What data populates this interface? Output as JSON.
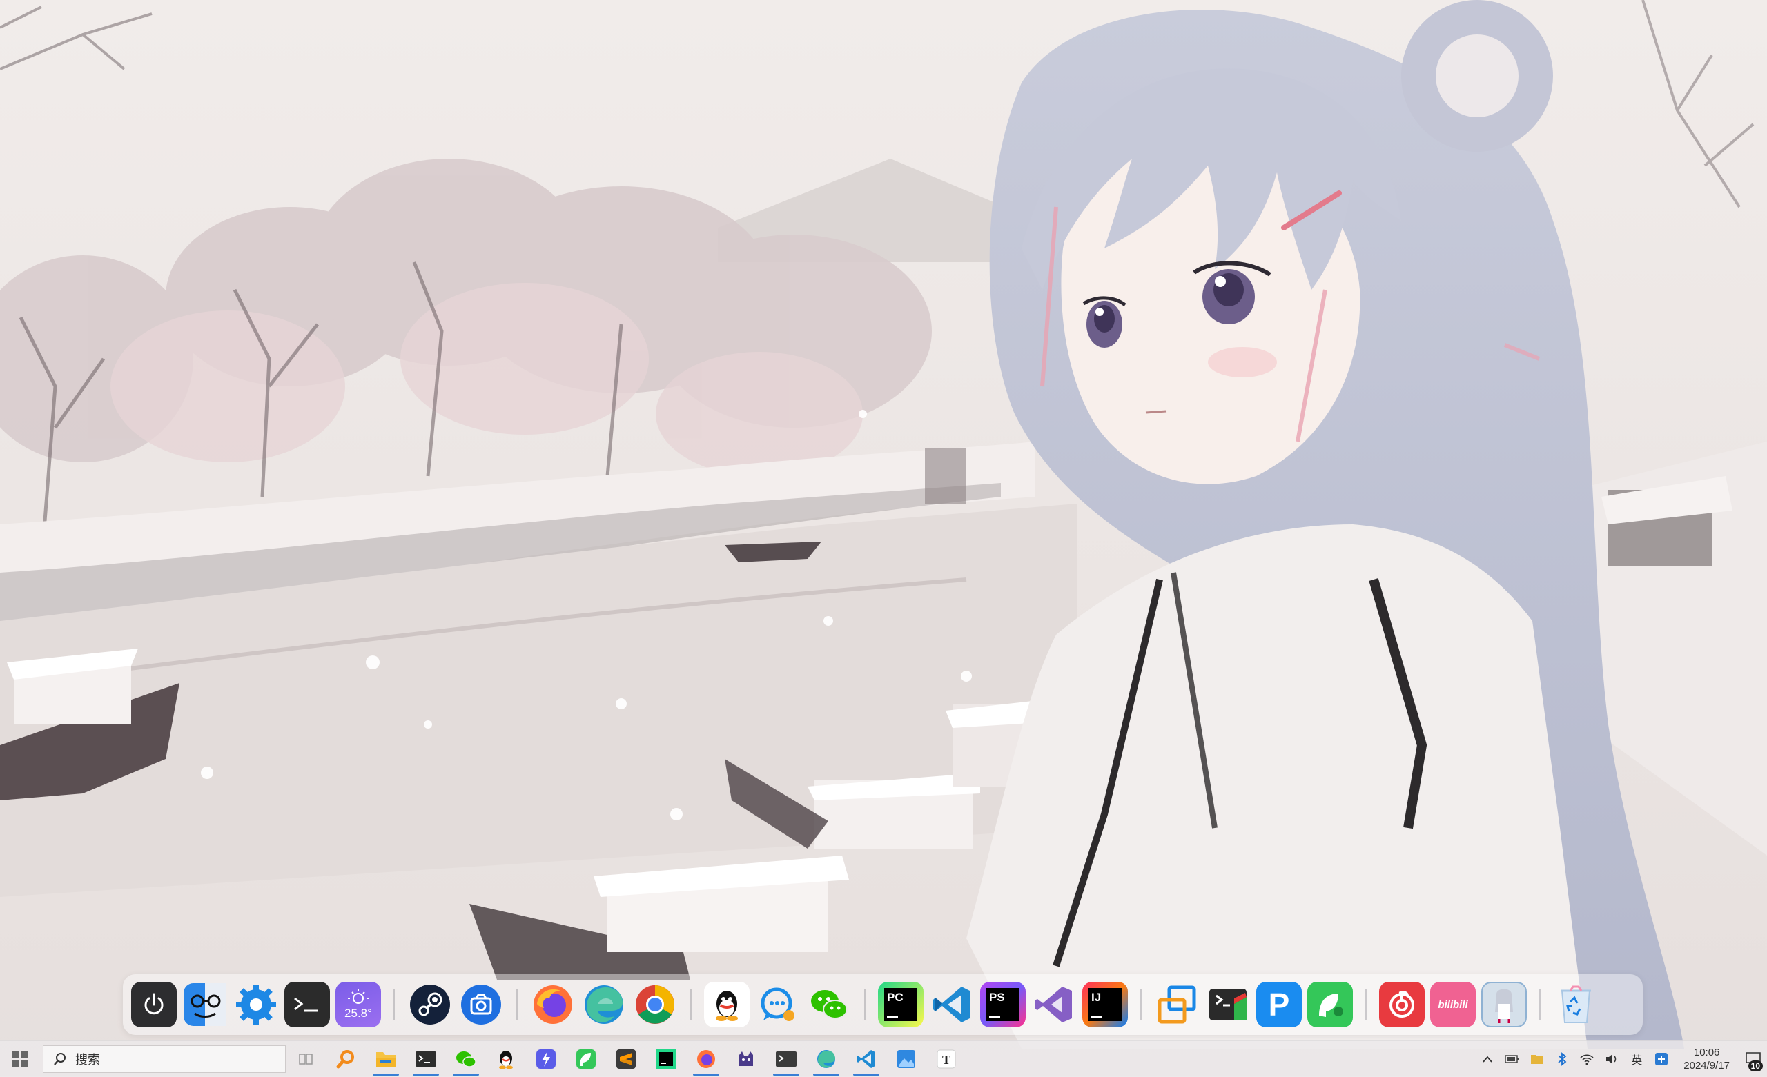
{
  "dock": {
    "apps": [
      {
        "name": "power"
      },
      {
        "name": "finder-face"
      },
      {
        "name": "settings"
      },
      {
        "name": "terminal"
      },
      {
        "name": "weather",
        "temperature": "25.8°"
      },
      {
        "name": "steam"
      },
      {
        "name": "screenshot"
      },
      {
        "name": "firefox"
      },
      {
        "name": "edge"
      },
      {
        "name": "chrome"
      },
      {
        "name": "qq"
      },
      {
        "name": "chat-bubble"
      },
      {
        "name": "wechat"
      },
      {
        "name": "pycharm",
        "label": "PC"
      },
      {
        "name": "vscode"
      },
      {
        "name": "phpstorm",
        "label": "PS"
      },
      {
        "name": "visual-studio"
      },
      {
        "name": "intellij",
        "label": "IJ"
      },
      {
        "name": "window-manager"
      },
      {
        "name": "windows-terminal"
      },
      {
        "name": "p-app",
        "label": "P"
      },
      {
        "name": "green-app"
      },
      {
        "name": "netease-music"
      },
      {
        "name": "bilibili",
        "label": "bilibili"
      },
      {
        "name": "character-card"
      },
      {
        "name": "recycle-bin"
      }
    ]
  },
  "taskbar": {
    "search_placeholder": "搜索",
    "apps": [
      "search-tool",
      "file-explorer",
      "terminal",
      "wechat",
      "qq",
      "lightning-app",
      "green-app",
      "sublime",
      "pycharm",
      "firefox",
      "github-cat",
      "console",
      "edge",
      "vscode",
      "photos",
      "typora"
    ],
    "tray": {
      "ime_label": "英",
      "time": "10:06",
      "date": "2024/9/17",
      "notification_count": "10"
    }
  },
  "colors": {
    "accent": "#3a7fd5",
    "dock_bg": "rgba(255,255,255,0.42)"
  }
}
